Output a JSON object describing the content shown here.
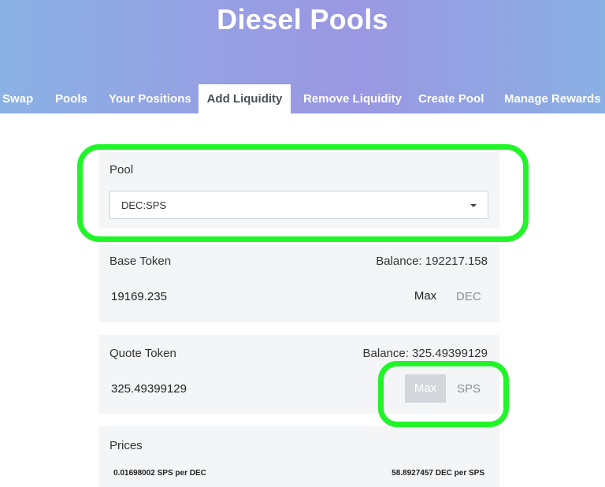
{
  "app": {
    "title": "Diesel Pools"
  },
  "tabs": [
    {
      "label": "Swap"
    },
    {
      "label": "Pools"
    },
    {
      "label": "Your Positions"
    },
    {
      "label": "Add Liquidity",
      "active": true
    },
    {
      "label": "Remove Liquidity"
    },
    {
      "label": "Create Pool"
    },
    {
      "label": "Manage Rewards"
    }
  ],
  "pool": {
    "label": "Pool",
    "selected": "DEC:SPS"
  },
  "base": {
    "label": "Base Token",
    "balance": "Balance: 192217.158",
    "amount": "19169.235",
    "max_label": "Max",
    "symbol": "DEC"
  },
  "quote": {
    "label": "Quote Token",
    "balance": "Balance: 325.49399129",
    "amount": "325.49399129",
    "max_label": "Max",
    "symbol": "SPS"
  },
  "prices": {
    "label": "Prices",
    "left": "0.01698002 SPS per DEC",
    "right": "58.8927457 DEC per SPS"
  },
  "colors": {
    "highlight": "#22f42a",
    "header_start": "#8ab1e4",
    "header_mid": "#9a98e2",
    "card_bg": "#f3f5f7"
  }
}
